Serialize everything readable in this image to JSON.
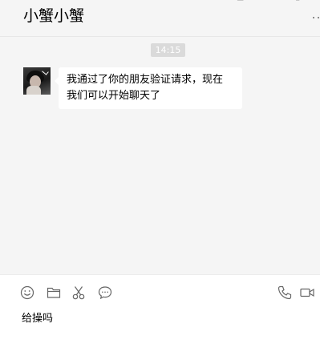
{
  "chat": {
    "title": "小蟹小蟹"
  },
  "messages": [
    {
      "type": "timestamp",
      "text": "14:15"
    },
    {
      "type": "incoming",
      "text_line1": "我通过了你的朋友验证请求，现在",
      "text_line2": "我们可以开始聊天了"
    }
  ],
  "toolbar": {
    "icons": [
      "emoji-icon",
      "folder-icon",
      "scissors-icon",
      "chat-bubble-icon",
      "phone-icon",
      "video-camera-icon"
    ]
  },
  "input": {
    "value": "给操吗"
  },
  "colors": {
    "window_bg": "#f5f5f5",
    "bubble_bg": "#ffffff",
    "timestamp_bg": "#dadada",
    "icon_stroke": "#666666"
  }
}
